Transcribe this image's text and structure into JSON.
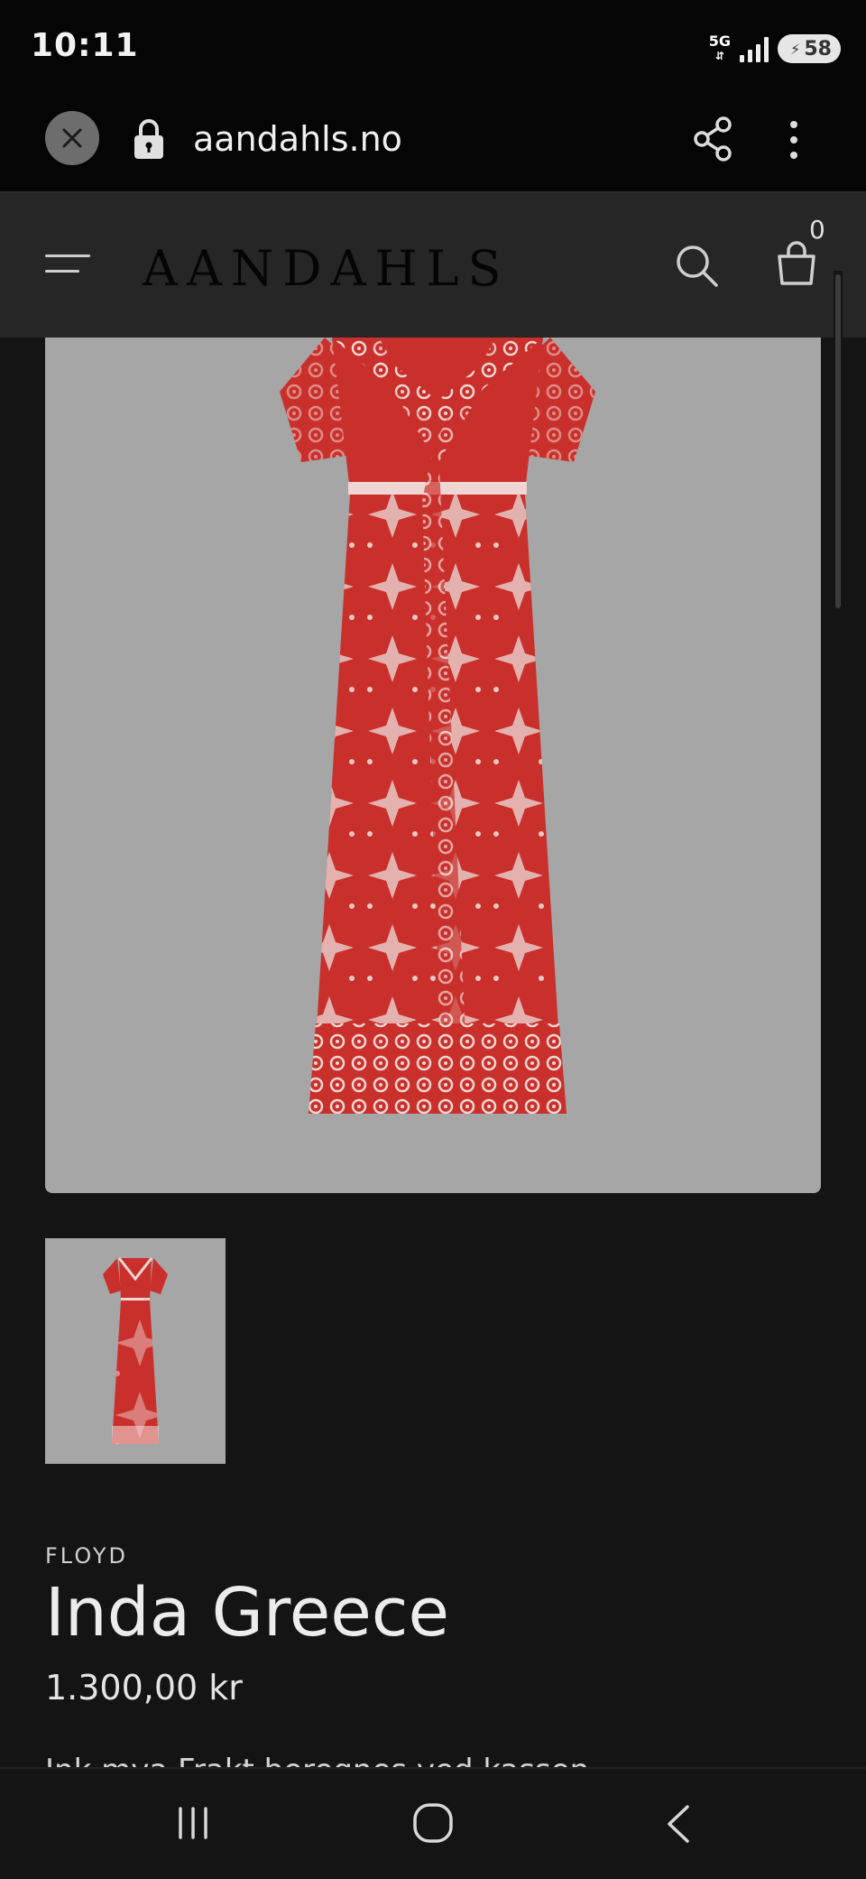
{
  "status_bar": {
    "time": "10:11",
    "network": "5G",
    "battery_level": "58"
  },
  "browser": {
    "url": "aandahls.no",
    "close_icon": "close-icon",
    "lock_icon": "lock-icon",
    "share_icon": "share-icon",
    "menu_icon": "more-vert-icon"
  },
  "site_header": {
    "logo_text": "AANDAHLS",
    "cart_count": "0"
  },
  "product": {
    "brand": "FLOYD",
    "name": "Inda Greece",
    "price": "1.300,00 kr",
    "tax_note": "Ink mva Frakt beregnes ved kassen",
    "dress_color": "#c9302c",
    "image_bg": "#a6a6a6"
  },
  "colors": {
    "page_bg": "#141414",
    "header_bg": "#262626",
    "status_bg": "#050505"
  }
}
